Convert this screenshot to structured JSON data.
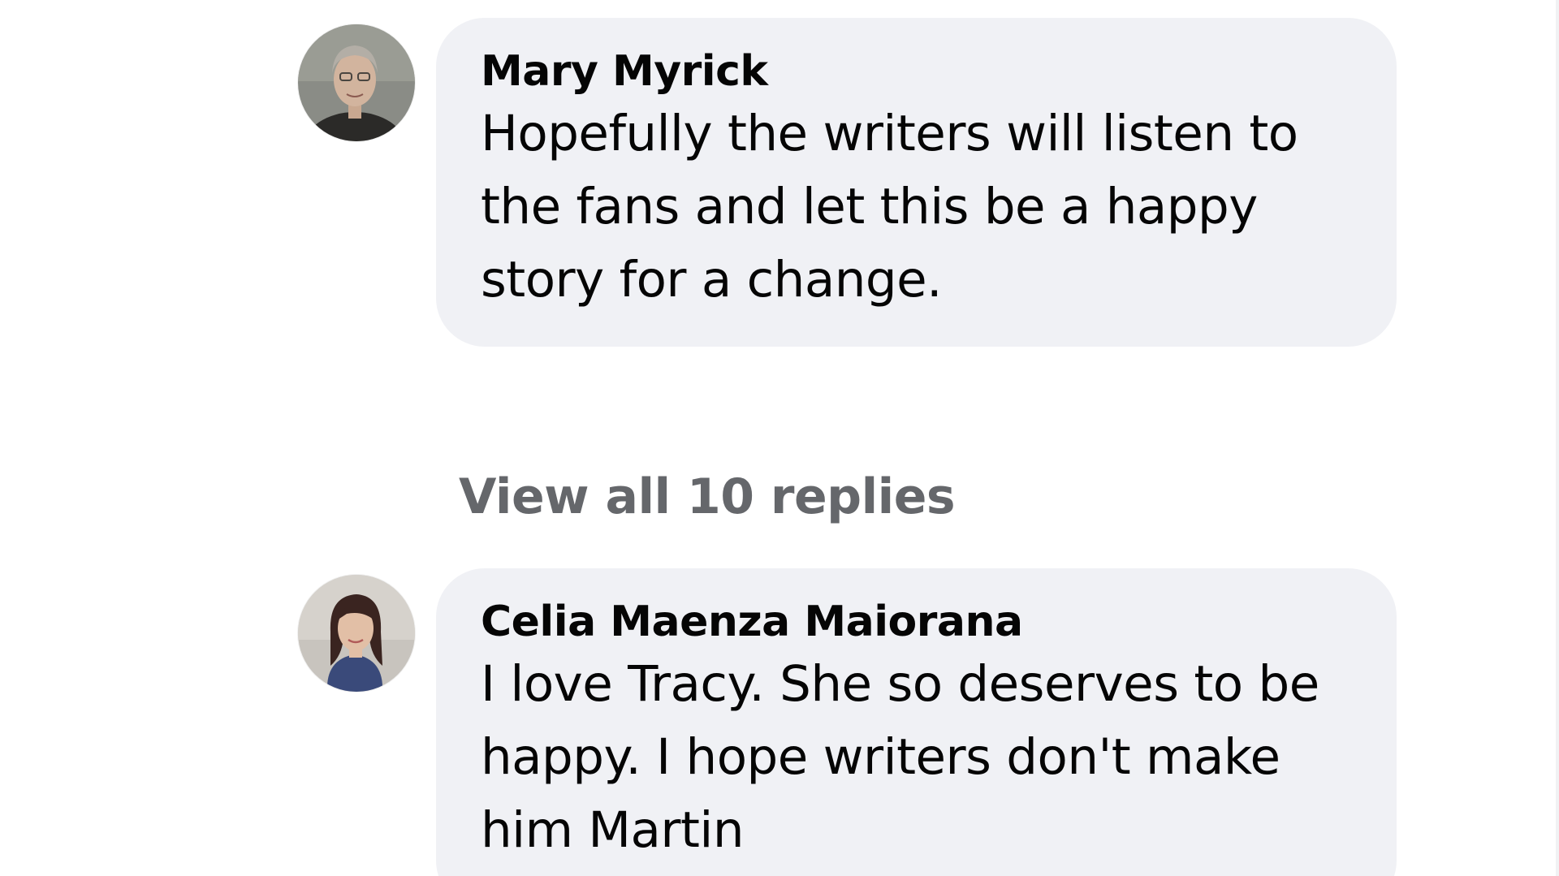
{
  "comments": [
    {
      "author": "Mary Myrick",
      "text": "Hopefully the writers will listen to the fans and let this be a happy story for a change."
    },
    {
      "author": "Celia Maenza Maiorana",
      "text": "I love Tracy. She so deserves to be happy. I hope writers don't make him Martin"
    }
  ],
  "view_replies": "View all 10 replies",
  "colors": {
    "bubble_background": "#f0f1f5",
    "text": "#050505",
    "secondary_text": "#65676b"
  }
}
